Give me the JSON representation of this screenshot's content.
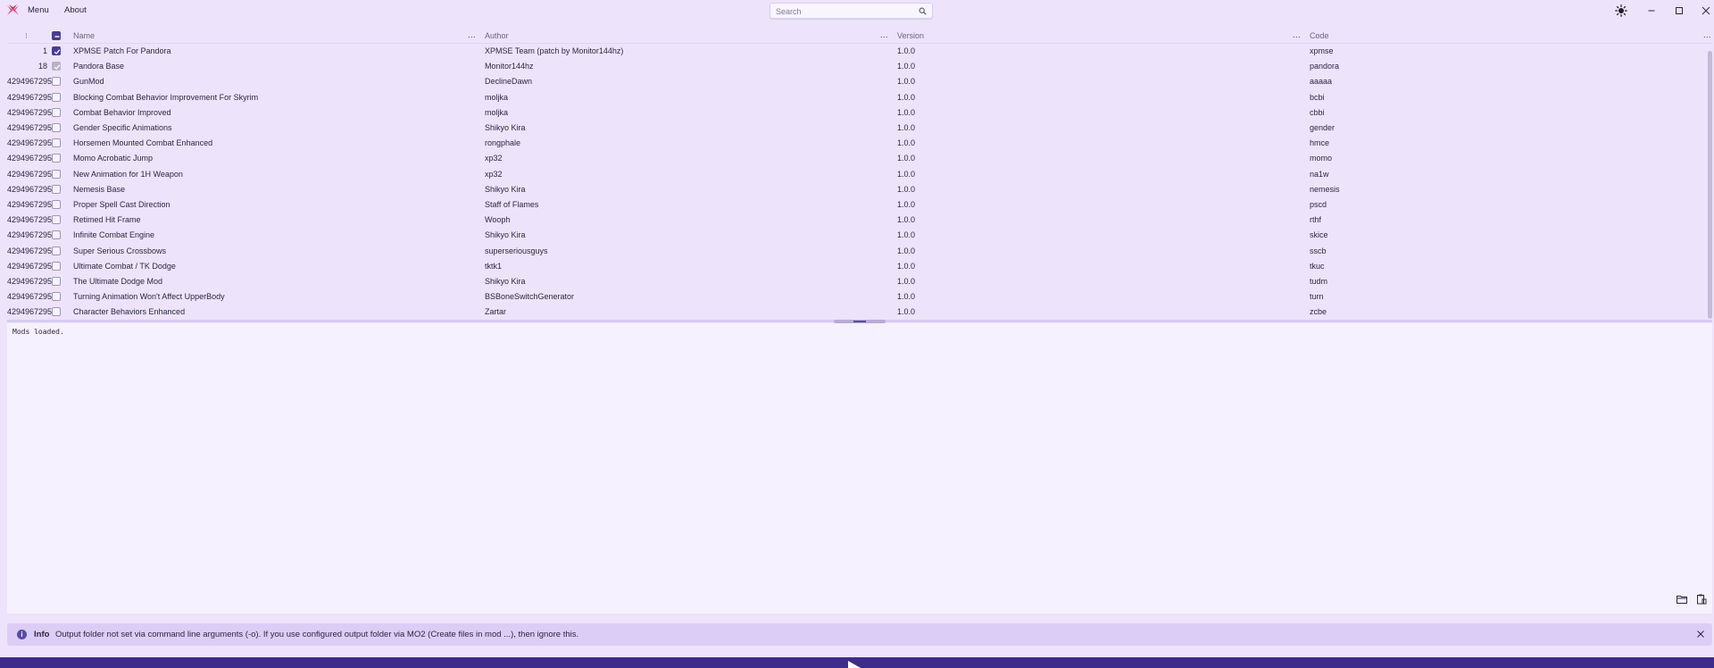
{
  "titlebar": {
    "menu_items": [
      "Menu",
      "About"
    ],
    "search_placeholder": "Search",
    "icons": [
      "app-logo-icon",
      "theme-toggle-icon",
      "minimize-icon",
      "maximize-icon",
      "close-icon"
    ]
  },
  "table": {
    "columns": {
      "priority": "⁝",
      "name": "Name",
      "author": "Author",
      "version": "Version",
      "code": "Code"
    },
    "column_menu": "...",
    "rows": [
      {
        "priority": "1",
        "state": "checked",
        "name": "XPMSE Patch For Pandora",
        "author": "XPMSE Team (patch by Monitor144hz)",
        "version": "1.0.0",
        "code": "xpmse"
      },
      {
        "priority": "18",
        "state": "disabled",
        "name": "Pandora Base",
        "author": "Monitor144hz",
        "version": "1.0.0",
        "code": "pandora"
      },
      {
        "priority": "4294967295",
        "state": "unchecked",
        "name": "GunMod",
        "author": "DeclineDawn",
        "version": "1.0.0",
        "code": "aaaaa"
      },
      {
        "priority": "4294967295",
        "state": "unchecked",
        "name": "Blocking Combat Behavior Improvement For Skyrim",
        "author": "moljka",
        "version": "1.0.0",
        "code": "bcbi"
      },
      {
        "priority": "4294967295",
        "state": "unchecked",
        "name": "Combat Behavior Improved",
        "author": "moljka",
        "version": "1.0.0",
        "code": "cbbi"
      },
      {
        "priority": "4294967295",
        "state": "unchecked",
        "name": "Gender Specific Animations",
        "author": "Shikyo Kira",
        "version": "1.0.0",
        "code": "gender"
      },
      {
        "priority": "4294967295",
        "state": "unchecked",
        "name": "Horsemen Mounted Combat Enhanced",
        "author": "rongphale",
        "version": "1.0.0",
        "code": "hmce"
      },
      {
        "priority": "4294967295",
        "state": "unchecked",
        "name": "Momo Acrobatic Jump",
        "author": "xp32",
        "version": "1.0.0",
        "code": "momo"
      },
      {
        "priority": "4294967295",
        "state": "unchecked",
        "name": "New Animation for 1H Weapon",
        "author": "xp32",
        "version": "1.0.0",
        "code": "na1w"
      },
      {
        "priority": "4294967295",
        "state": "unchecked",
        "name": "Nemesis Base",
        "author": "Shikyo Kira",
        "version": "1.0.0",
        "code": "nemesis"
      },
      {
        "priority": "4294967295",
        "state": "unchecked",
        "name": "Proper Spell Cast Direction",
        "author": "Staff of Flames",
        "version": "1.0.0",
        "code": "pscd"
      },
      {
        "priority": "4294967295",
        "state": "unchecked",
        "name": "Retimed Hit Frame",
        "author": "Wooph",
        "version": "1.0.0",
        "code": "rthf"
      },
      {
        "priority": "4294967295",
        "state": "unchecked",
        "name": "Infinite Combat Engine",
        "author": "Shikyo Kira",
        "version": "1.0.0",
        "code": "skice"
      },
      {
        "priority": "4294967295",
        "state": "unchecked",
        "name": "Super Serious Crossbows",
        "author": "superseriousguys",
        "version": "1.0.0",
        "code": "sscb"
      },
      {
        "priority": "4294967295",
        "state": "unchecked",
        "name": "Ultimate Combat / TK Dodge",
        "author": "tktk1",
        "version": "1.0.0",
        "code": "tkuc"
      },
      {
        "priority": "4294967295",
        "state": "unchecked",
        "name": "The Ultimate Dodge Mod",
        "author": "Shikyo Kira",
        "version": "1.0.0",
        "code": "tudm"
      },
      {
        "priority": "4294967295",
        "state": "unchecked",
        "name": "Turning Animation Won't Affect UpperBody",
        "author": "BSBoneSwitchGenerator",
        "version": "1.0.0",
        "code": "turn"
      },
      {
        "priority": "4294967295",
        "state": "unchecked",
        "name": "Character Behaviors Enhanced",
        "author": "Zartar",
        "version": "1.0.0",
        "code": "zcbe"
      }
    ]
  },
  "log": {
    "text": "Mods loaded.",
    "icons": [
      "open-folder-icon",
      "clipboard-icon"
    ]
  },
  "info_bar": {
    "title": "Info",
    "message": "Output folder not set via command line arguments (-o). If you use configured output folder via MO2 (Create files in mod ...), then ignore this."
  },
  "colors": {
    "background": "#ede4fb",
    "accent": "#4b3a99",
    "run_bar": "#3d2c8f",
    "info_bar": "#dccdf6"
  }
}
